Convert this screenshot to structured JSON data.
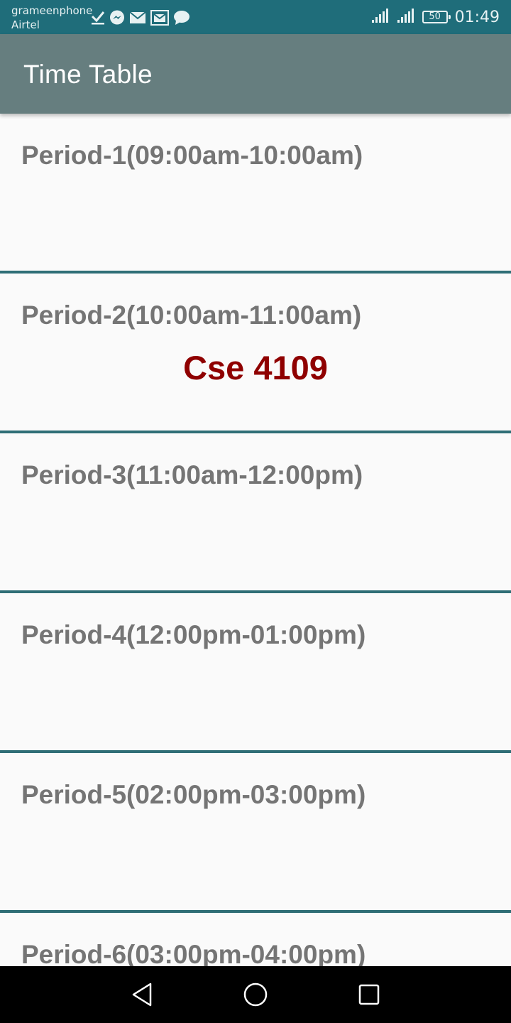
{
  "status_bar": {
    "carrier_1": "grameenphone",
    "carrier_2": "Airtel",
    "battery": "50",
    "time": "01:49",
    "notification_icons": [
      "check-icon",
      "messenger-icon",
      "mail-icon",
      "gmail-icon",
      "chat-icon"
    ],
    "status_icons": [
      "signal-icon",
      "signal-icon",
      "battery-icon"
    ]
  },
  "app_bar": {
    "title": "Time Table",
    "color": "#667e7f"
  },
  "periods": [
    {
      "label": "Period-1(09:00am-10:00am)",
      "course": ""
    },
    {
      "label": "Period-2(10:00am-11:00am)",
      "course": "Cse 4109"
    },
    {
      "label": "Period-3(11:00am-12:00pm)",
      "course": ""
    },
    {
      "label": "Period-4(12:00pm-01:00pm)",
      "course": ""
    },
    {
      "label": "Period-5(02:00pm-03:00pm)",
      "course": ""
    },
    {
      "label": "Period-6(03:00pm-04:00pm)",
      "course": ""
    }
  ],
  "colors": {
    "status_bar": "#1f6d7a",
    "divider": "#2f6e76",
    "period_text": "#757575",
    "course_text": "#8f0000"
  },
  "nav_bar": {
    "buttons": [
      "back-icon",
      "home-icon",
      "recents-icon"
    ]
  }
}
